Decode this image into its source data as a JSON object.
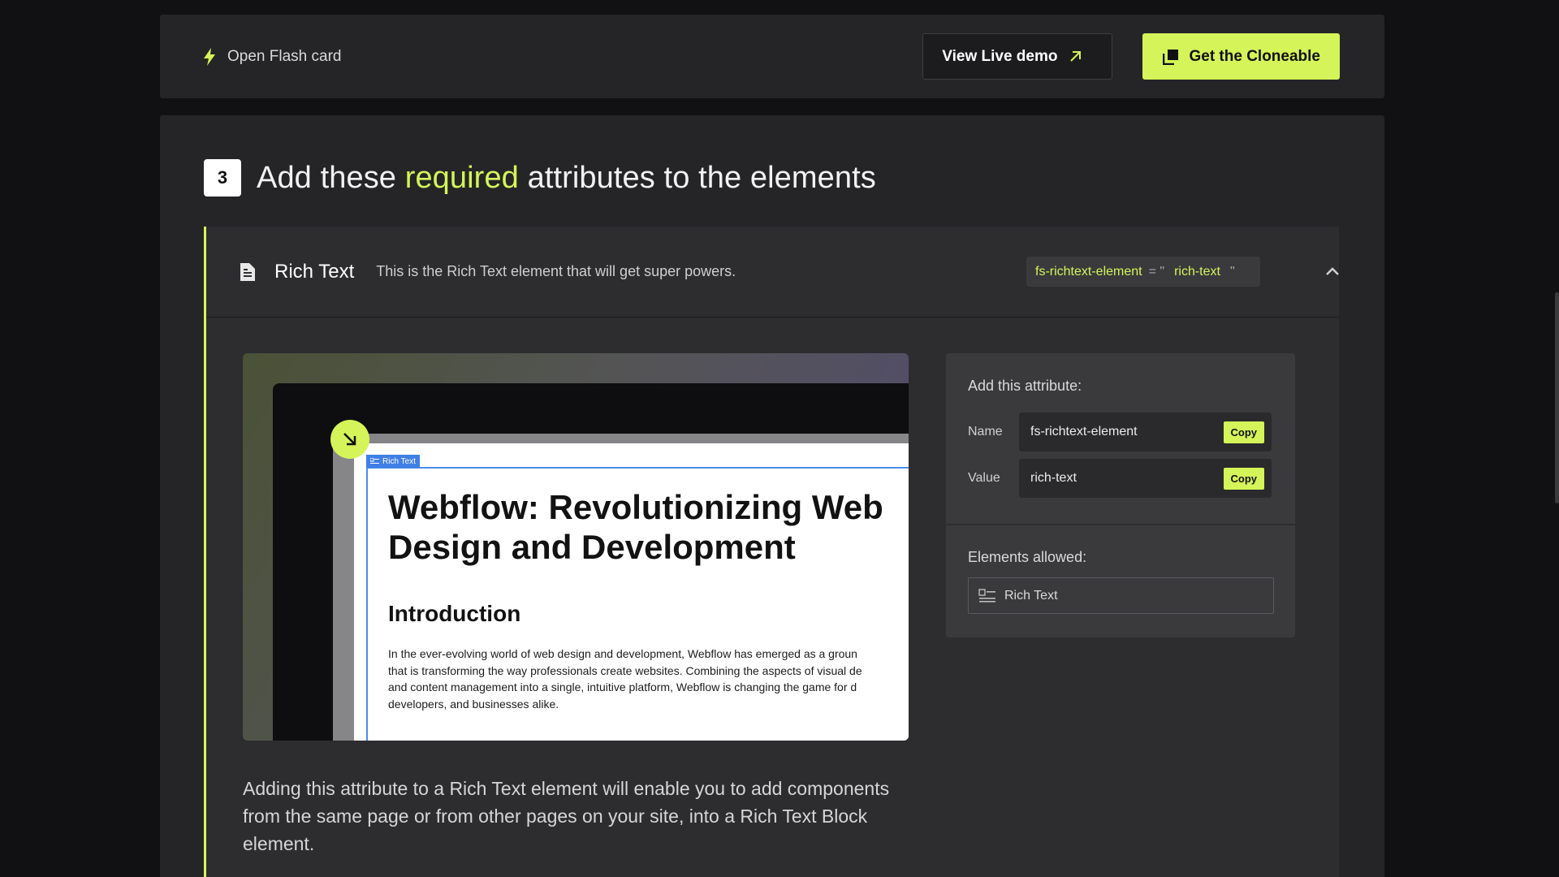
{
  "topbar": {
    "flash_label": "Open Flash card",
    "live_demo_label": "View Live demo",
    "cloneable_label": "Get the Cloneable"
  },
  "step": {
    "number": "3",
    "heading_before": "Add these ",
    "heading_accent": "required",
    "heading_after": " attributes to the elements"
  },
  "panel": {
    "title": "Rich Text",
    "description": "This is the Rich Text element that will get super powers.",
    "chip": {
      "name": "fs-richtext-element",
      "equals": " = \"",
      "value": "rich-text",
      "close_quote": "\""
    }
  },
  "preview": {
    "tag_label": "Rich Text",
    "doc_heading": "Webflow: Revolutionizing Web\nDesign and Development",
    "doc_subheading": "Introduction",
    "doc_paragraph": "In the ever-evolving world of web design and development, Webflow has emerged as a groun\nthat is transforming the way professionals create websites. Combining the aspects of visual de\nand content management into a single, intuitive platform, Webflow is changing the game for d\ndevelopers, and businesses alike."
  },
  "body_text": "Adding this attribute to a Rich Text element will enable you to add components from the same page or from other pages on your site, into a Rich Text Block element.",
  "attribute_box": {
    "label": "Add this attribute:",
    "name_label": "Name",
    "name_value": "fs-richtext-element",
    "value_label": "Value",
    "value_value": "rich-text",
    "copy_label": "Copy",
    "allowed_label": "Elements allowed:",
    "allowed_item": "Rich Text"
  },
  "colors": {
    "accent": "#d4f459",
    "background": "#111113",
    "card": "#252527",
    "selection_blue": "#3f7fe6"
  },
  "icons": [
    "lightning-icon",
    "arrow-up-right-icon",
    "clone-icon",
    "document-icon",
    "chevron-up-icon",
    "arrow-down-right-icon",
    "rich-text-icon"
  ]
}
